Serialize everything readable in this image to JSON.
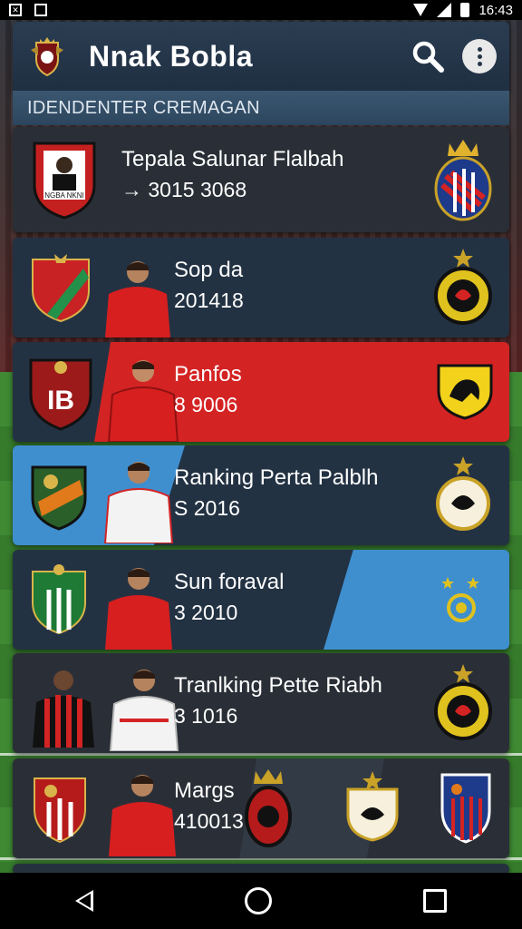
{
  "status": {
    "time": "16:43"
  },
  "app": {
    "title": "Nnak Bobla"
  },
  "section": {
    "title": "IDENDENTER CREMAGAN"
  },
  "cards": [
    {
      "title": "Tepala Salunar Flalbah",
      "subtitle": "→ 3015 3068"
    },
    {
      "title": "Sop da",
      "subtitle": "201418"
    },
    {
      "title": "Panfos",
      "subtitle": "8 9006"
    },
    {
      "title": "Ranking Perta Palblh",
      "subtitle": "S 2016"
    },
    {
      "title": "Sun foraval",
      "subtitle": "3 2010"
    },
    {
      "title": "Tranlking  Pette Riabh",
      "subtitle": "3 1016"
    },
    {
      "title": "Margs",
      "subtitle": "410013"
    }
  ],
  "crest_texts": {
    "card0_left": "NGBA NKNI",
    "card2_left": "IB"
  },
  "icons": [
    "search-icon",
    "more-vert-icon",
    "back-icon",
    "home-icon",
    "recents-icon"
  ],
  "colors": {
    "appbar": "#2b3d52",
    "card": "#26313e",
    "red": "#d42323",
    "blue": "#3f8fcf"
  }
}
